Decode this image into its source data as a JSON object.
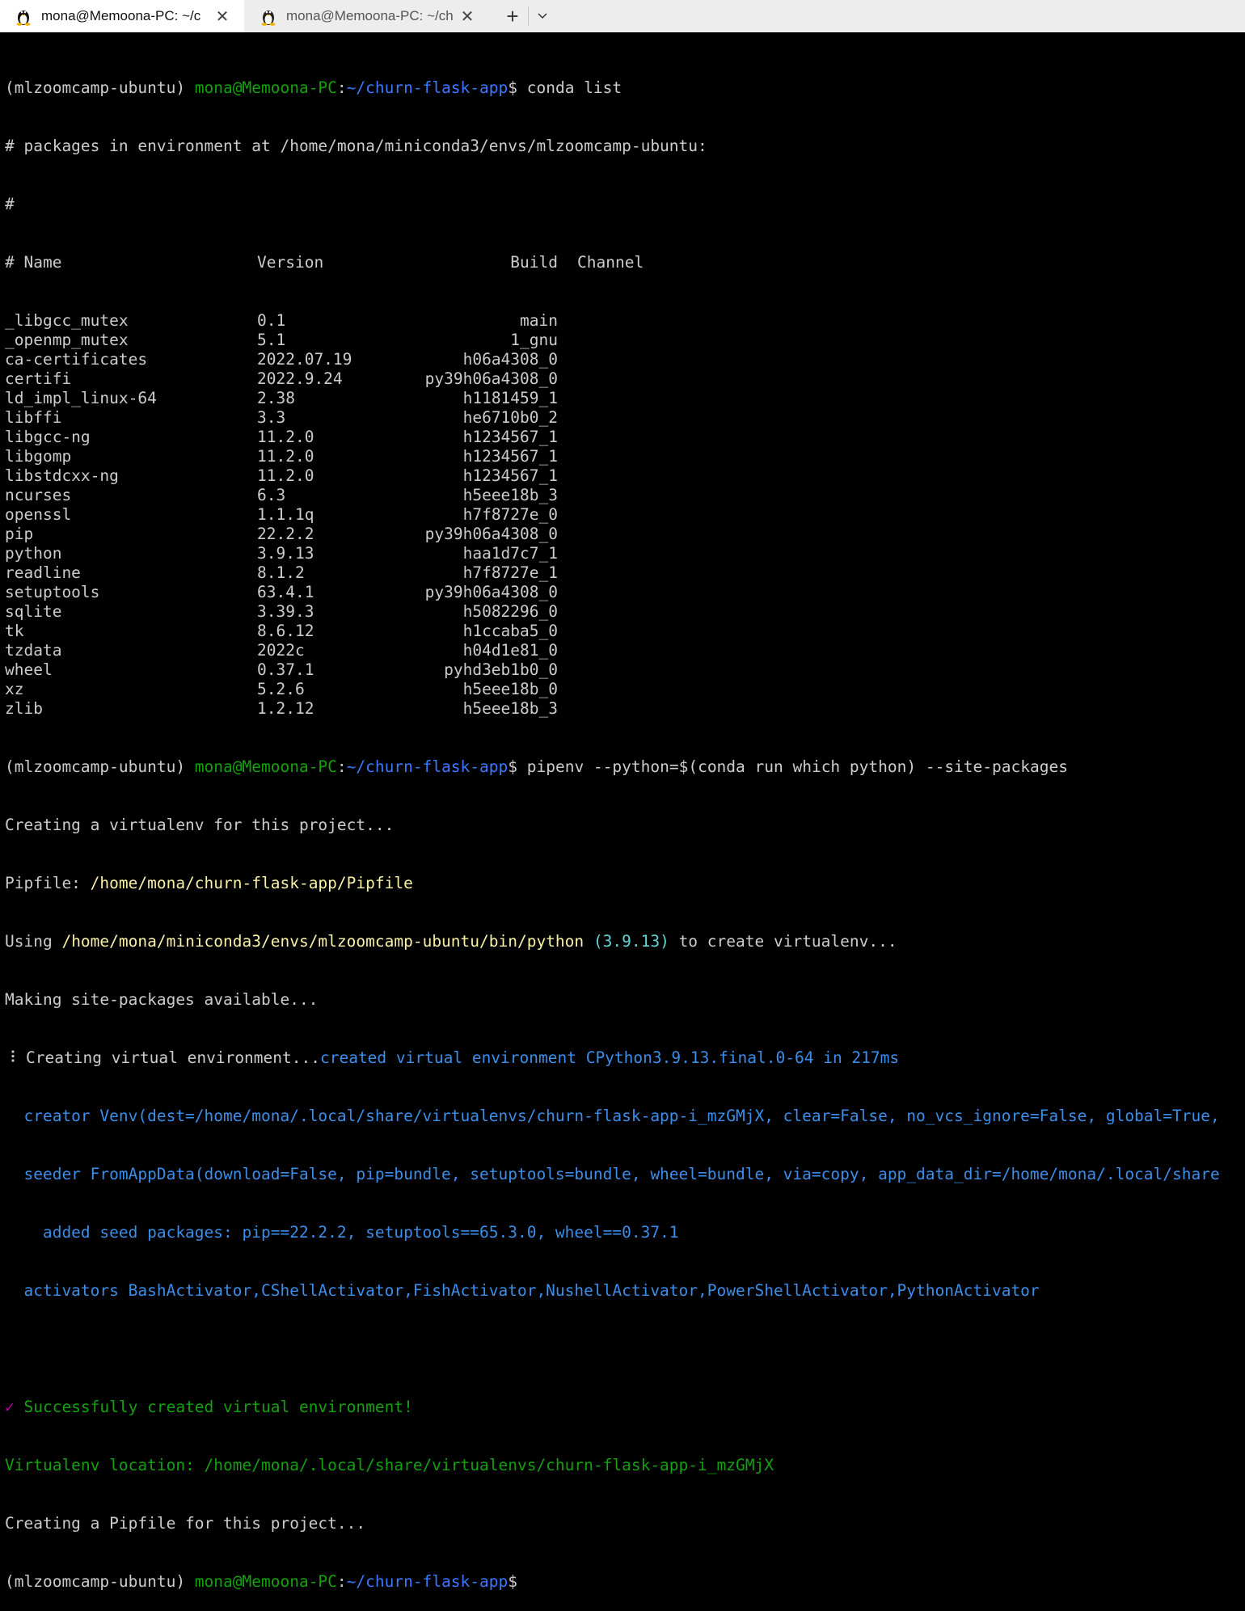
{
  "tabs": [
    {
      "title": "mona@Memoona-PC: ~/c",
      "icon": "linux-penguin-icon",
      "close": "✕"
    },
    {
      "title": "mona@Memoona-PC: ~/ch",
      "icon": "linux-penguin-icon",
      "close": "✕"
    }
  ],
  "newtab": "+",
  "prompt": {
    "env": "(mlzoomcamp-ubuntu) ",
    "user": "mona@Memoona-PC",
    "colon": ":",
    "path": "~/churn-flask-app",
    "dollar": "$"
  },
  "cmd1": " conda list",
  "header": [
    "# packages in environment at /home/mona/miniconda3/envs/mlzoomcamp-ubuntu:",
    "#"
  ],
  "columns": {
    "name": "# Name",
    "version": "Version",
    "build": "Build",
    "channel": "Channel"
  },
  "packages": [
    {
      "name": "_libgcc_mutex",
      "version": "0.1",
      "build": "main"
    },
    {
      "name": "_openmp_mutex",
      "version": "5.1",
      "build": "1_gnu"
    },
    {
      "name": "ca-certificates",
      "version": "2022.07.19",
      "build": "h06a4308_0"
    },
    {
      "name": "certifi",
      "version": "2022.9.24",
      "build": "py39h06a4308_0"
    },
    {
      "name": "ld_impl_linux-64",
      "version": "2.38",
      "build": "h1181459_1"
    },
    {
      "name": "libffi",
      "version": "3.3",
      "build": "he6710b0_2"
    },
    {
      "name": "libgcc-ng",
      "version": "11.2.0",
      "build": "h1234567_1"
    },
    {
      "name": "libgomp",
      "version": "11.2.0",
      "build": "h1234567_1"
    },
    {
      "name": "libstdcxx-ng",
      "version": "11.2.0",
      "build": "h1234567_1"
    },
    {
      "name": "ncurses",
      "version": "6.3",
      "build": "h5eee18b_3"
    },
    {
      "name": "openssl",
      "version": "1.1.1q",
      "build": "h7f8727e_0"
    },
    {
      "name": "pip",
      "version": "22.2.2",
      "build": "py39h06a4308_0"
    },
    {
      "name": "python",
      "version": "3.9.13",
      "build": "haa1d7c7_1"
    },
    {
      "name": "readline",
      "version": "8.1.2",
      "build": "h7f8727e_1"
    },
    {
      "name": "setuptools",
      "version": "63.4.1",
      "build": "py39h06a4308_0"
    },
    {
      "name": "sqlite",
      "version": "3.39.3",
      "build": "h5082296_0"
    },
    {
      "name": "tk",
      "version": "8.6.12",
      "build": "h1ccaba5_0"
    },
    {
      "name": "tzdata",
      "version": "2022c",
      "build": "h04d1e81_0"
    },
    {
      "name": "wheel",
      "version": "0.37.1",
      "build": "pyhd3eb1b0_0"
    },
    {
      "name": "xz",
      "version": "5.2.6",
      "build": "h5eee18b_0"
    },
    {
      "name": "zlib",
      "version": "1.2.12",
      "build": "h5eee18b_3"
    }
  ],
  "cmd2": " pipenv --python=$(conda run which python) --site-packages",
  "out": {
    "creating_venv": "Creating a virtualenv for this project...",
    "pipfile_label": "Pipfile: ",
    "pipfile_path": "/home/mona/churn-flask-app/Pipfile",
    "using_label": "Using ",
    "using_path": "/home/mona/miniconda3/envs/mlzoomcamp-ubuntu/bin/python",
    "using_version": " (3.9.13)",
    "using_rest": " to create virtualenv...",
    "making": "Making site-packages available...",
    "spinner": "⠸",
    "creating_env": " Creating virtual environment...",
    "created_msg": "created virtual environment CPython3.9.13.final.0-64 in 217ms",
    "creator": "  creator Venv(dest=/home/mona/.local/share/virtualenvs/churn-flask-app-i_mzGMjX, clear=False, no_vcs_ignore=False, global=True,",
    "seeder": "  seeder FromAppData(download=False, pip=bundle, setuptools=bundle, wheel=bundle, via=copy, app_data_dir=/home/mona/.local/share",
    "added": "    added seed packages: pip==22.2.2, setuptools==65.3.0, wheel==0.37.1",
    "activators": "  activators BashActivator,CShellActivator,FishActivator,NushellActivator,PowerShellActivator,PythonActivator",
    "check": "✓",
    "success": " Successfully created virtual environment!",
    "venv_location": "Virtualenv location: /home/mona/.local/share/virtualenvs/churn-flask-app-i_mzGMjX",
    "creating_pipfile": "Creating a Pipfile for this project..."
  },
  "colors": {
    "background": "#000000",
    "foreground": "#cccccc",
    "prompt_user": "#13a10e",
    "prompt_path": "#3b78ff",
    "path_yellow": "#f9f1a5",
    "version_cyan": "#61d6d6",
    "venv_blue": "#3b8eea",
    "tab_active": "#ffffff",
    "tabbar": "#ededed"
  }
}
